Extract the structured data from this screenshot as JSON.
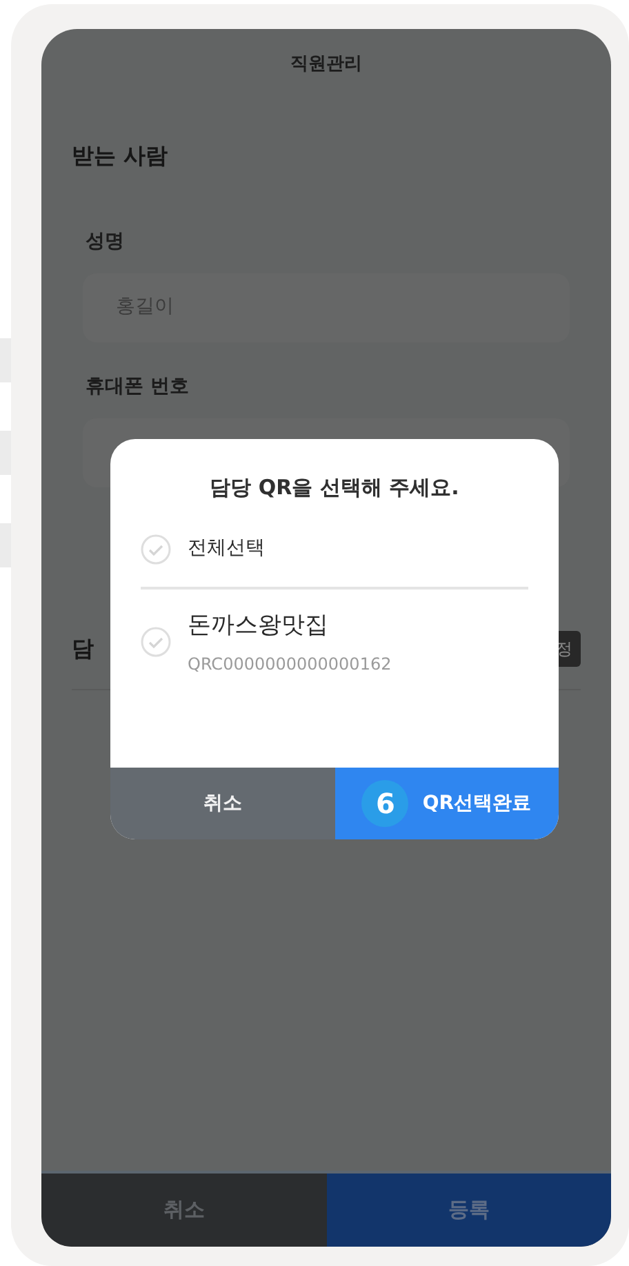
{
  "header": {
    "title": "직원관리"
  },
  "section": {
    "title": "받는 사람"
  },
  "fields": [
    {
      "label": "성명",
      "value": "홍길이"
    },
    {
      "label": "휴대폰 번호"
    }
  ],
  "assignment": {
    "label": "담",
    "button": "정"
  },
  "dialog": {
    "title": "담당 QR을 선택해 주세요.",
    "select_all": {
      "label": "전체선택",
      "checked": false
    },
    "items": [
      {
        "name": "돈까스왕맛집",
        "code": "QRC0000000000000162",
        "checked": false
      }
    ],
    "buttons": [
      {
        "label": "취소",
        "kind": "cancel"
      },
      {
        "label": "QR선택완료",
        "kind": "confirm"
      }
    ],
    "badge": "6"
  },
  "footer": {
    "buttons": [
      {
        "label": "취소",
        "kind": "cancel"
      },
      {
        "label": "등록",
        "kind": "confirm"
      }
    ]
  }
}
